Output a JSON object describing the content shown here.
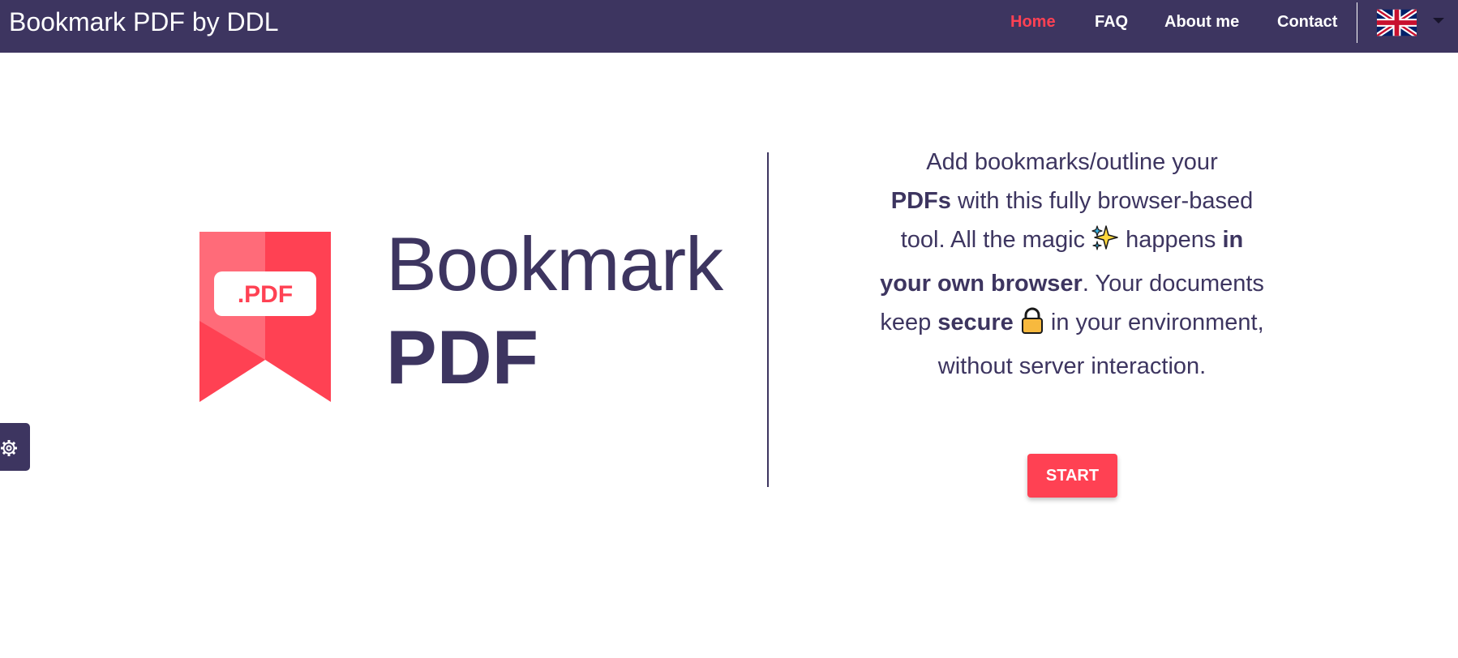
{
  "app": {
    "brand": "Bookmark PDF by DDL"
  },
  "nav": {
    "items": [
      {
        "label": "Home",
        "active": true
      },
      {
        "label": "FAQ",
        "active": false
      },
      {
        "label": "About me",
        "active": false
      },
      {
        "label": "Contact",
        "active": false
      }
    ],
    "language_icon": "uk-flag-icon",
    "language_caret_icon": "caret-down-icon"
  },
  "settings": {
    "icon": "gear-icon"
  },
  "hero": {
    "badge_text": ".PDF",
    "title_line1": "Bookmark",
    "title_line2": "PDF",
    "tagline": {
      "s1": "Add bookmarks/outline your",
      "s2_bold": "PDFs",
      "s3": " with this fully browser-based tool. All the magic ",
      "emoji1": "sparkles-icon",
      "s4": " happens ",
      "s5_bold": "in your own browser",
      "s6": ". Your documents keep ",
      "s7_bold": "secure",
      "emoji2": "lock-icon",
      "s8": " in your environment, without server interaction."
    },
    "start_label": "START"
  },
  "colors": {
    "navbar": "#3d3560",
    "accent": "#ff4153",
    "text": "#3d3560",
    "background": "#ffffff"
  }
}
